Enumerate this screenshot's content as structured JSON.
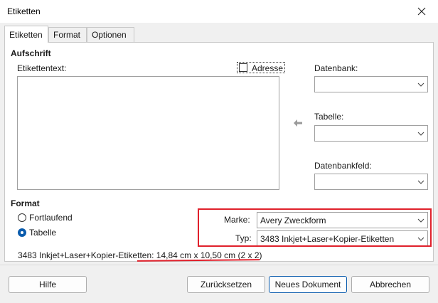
{
  "window": {
    "title": "Etiketten",
    "close_icon": "close-icon"
  },
  "tabs": [
    {
      "label": "Etiketten",
      "active": true
    },
    {
      "label": "Format",
      "active": false
    },
    {
      "label": "Optionen",
      "active": false
    }
  ],
  "aufschrift": {
    "heading": "Aufschrift",
    "etikettentext_label": "Etikettentext:",
    "adresse_label": "Adresse",
    "adresse_checked": false,
    "datenbank_label": "Datenbank:",
    "datenbank_value": "",
    "tabelle_label": "Tabelle:",
    "tabelle_value": "",
    "datenbankfeld_label": "Datenbankfeld:",
    "datenbankfeld_value": ""
  },
  "format": {
    "heading": "Format",
    "fortlaufend_label": "Fortlaufend",
    "tabelle_label": "Tabelle",
    "selected": "Tabelle",
    "marke_label": "Marke:",
    "marke_value": "Avery Zweckform",
    "typ_label": "Typ:",
    "typ_value": "3483 Inkjet+Laser+Kopier-Etiketten",
    "info_text": "3483 Inkjet+Laser+Kopier-Etiketten: 14,84 cm x 10,50 cm (2 x 2)"
  },
  "buttons": {
    "hilfe": "Hilfe",
    "zuruecksetzen": "Zurücksetzen",
    "neues_dokument": "Neues Dokument",
    "abbrechen": "Abbrechen"
  },
  "colors": {
    "highlight": "#e0202b",
    "accent": "#0b5cad"
  }
}
